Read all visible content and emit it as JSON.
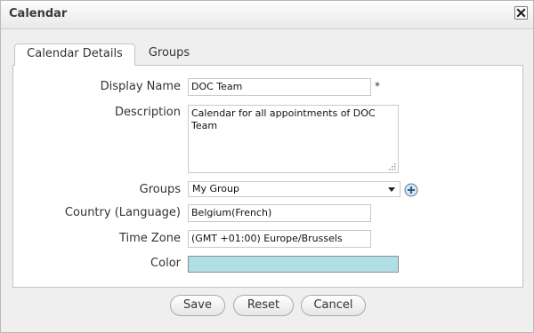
{
  "dialog": {
    "title": "Calendar"
  },
  "tabs": [
    {
      "label": "Calendar Details",
      "active": true
    },
    {
      "label": "Groups",
      "active": false
    }
  ],
  "form": {
    "display_name": {
      "label": "Display Name",
      "value": "DOC Team",
      "required_mark": "*"
    },
    "description": {
      "label": "Description",
      "value": "Calendar for all appointments of DOC Team"
    },
    "groups": {
      "label": "Groups",
      "selected": "My Group"
    },
    "country": {
      "label": "Country (Language)",
      "value": "Belgium(French)"
    },
    "time_zone": {
      "label": "Time Zone",
      "value": "(GMT +01:00) Europe/Brussels"
    },
    "color": {
      "label": "Color",
      "value": "#b0e0e6"
    }
  },
  "buttons": {
    "save": "Save",
    "reset": "Reset",
    "cancel": "Cancel"
  },
  "icons": {
    "close": "close-icon",
    "add": "plus-circle-icon",
    "dropdown": "chevron-down-icon",
    "resize": "resize-grip-icon"
  }
}
